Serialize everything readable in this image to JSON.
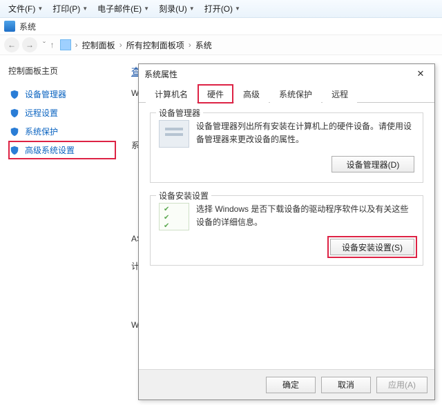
{
  "menubar": {
    "items": [
      {
        "label": "文件(F)"
      },
      {
        "label": "打印(P)"
      },
      {
        "label": "电子邮件(E)"
      },
      {
        "label": "刻录(U)"
      },
      {
        "label": "打开(O)"
      }
    ]
  },
  "toolrow": {
    "label": "系统"
  },
  "breadcrumb": {
    "items": [
      "控制面板",
      "所有控制面板项",
      "系统"
    ]
  },
  "sidebar": {
    "title": "控制面板主页",
    "links": [
      {
        "label": "设备管理器"
      },
      {
        "label": "远程设置"
      },
      {
        "label": "系统保护"
      },
      {
        "label": "高级系统设置",
        "highlight": true
      }
    ]
  },
  "main": {
    "heading": "查",
    "letters": [
      "W",
      "系",
      "AS",
      "计",
      "W"
    ]
  },
  "dialog": {
    "title": "系统属性",
    "tabs": [
      {
        "label": "计算机名"
      },
      {
        "label": "硬件",
        "active": true
      },
      {
        "label": "高级"
      },
      {
        "label": "系统保护"
      },
      {
        "label": "远程"
      }
    ],
    "group_devmgr": {
      "legend": "设备管理器",
      "desc": "设备管理器列出所有安装在计算机上的硬件设备。请使用设备管理器来更改设备的属性。",
      "button": "设备管理器(D)"
    },
    "group_devinst": {
      "legend": "设备安装设置",
      "desc": "选择 Windows 是否下载设备的驱动程序软件以及有关这些设备的详细信息。",
      "button": "设备安装设置(S)"
    },
    "footer": {
      "ok": "确定",
      "cancel": "取消",
      "apply": "应用(A)"
    }
  }
}
